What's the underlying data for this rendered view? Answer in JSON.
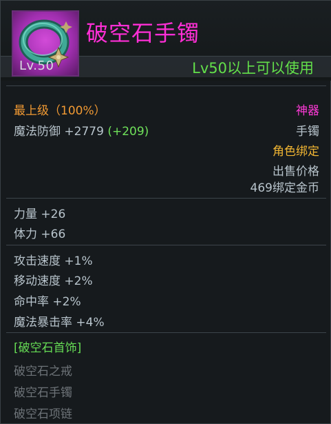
{
  "item": {
    "name": "破空石手镯",
    "level_badge": "Lv.50",
    "requirement": "Lv50以上可以使用",
    "grade": "最上级（100%）",
    "category": "神器",
    "slot": "手镯",
    "magic_defense": "魔法防御 +2779",
    "magic_defense_bonus": "(+209)",
    "binding": "角色绑定",
    "sell_label": "出售价格",
    "sell_value": "469绑定金币"
  },
  "stats_primary": [
    "力量 +26",
    "体力 +66"
  ],
  "stats_secondary": [
    "攻击速度 +1%",
    "移动速度 +2%",
    "命中率 +2%",
    "魔法暴击率 +4%"
  ],
  "set": {
    "title": "[破空石首饰]",
    "pieces": [
      "破空石之戒",
      "破空石手镯",
      "破空石项链"
    ]
  },
  "colors": {
    "name": "#ff2fd6",
    "requirement": "#63e04a",
    "grade": "#f29a33",
    "category": "#ff3ad8",
    "binding": "#f2b633",
    "set_title": "#66dd55",
    "set_inactive": "#6d7378"
  },
  "icons": {
    "item_icon": "bracelet-icon"
  }
}
